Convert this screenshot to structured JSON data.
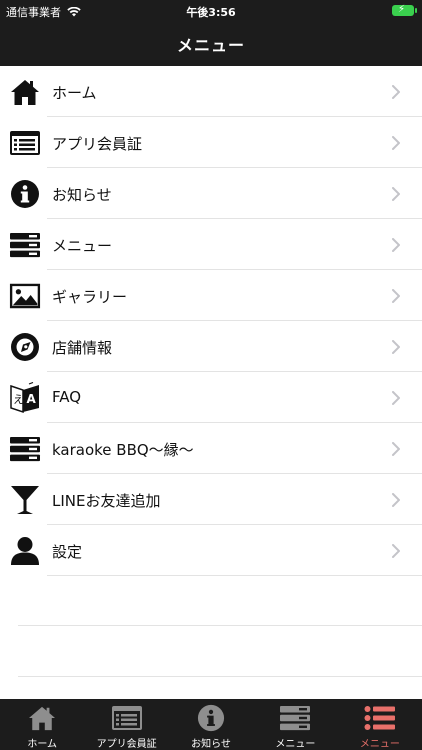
{
  "status_bar": {
    "carrier": "通信事業者",
    "time": "午後3:56",
    "battery_color": "#3ad04e"
  },
  "nav": {
    "title": "メニュー"
  },
  "menu": {
    "items": [
      {
        "label": "ホーム",
        "icon": "home-icon"
      },
      {
        "label": "アプリ会員証",
        "icon": "member-card-icon"
      },
      {
        "label": "お知らせ",
        "icon": "info-icon"
      },
      {
        "label": "メニュー",
        "icon": "menu-list-icon"
      },
      {
        "label": "ギャラリー",
        "icon": "gallery-icon"
      },
      {
        "label": "店舗情報",
        "icon": "compass-icon"
      },
      {
        "label": "FAQ",
        "icon": "translate-icon"
      },
      {
        "label": "karaoke BBQ〜縁〜",
        "icon": "menu-list-icon"
      },
      {
        "label": "LINEお友達追加",
        "icon": "cocktail-icon"
      },
      {
        "label": "設定",
        "icon": "user-icon"
      }
    ]
  },
  "tabbar": {
    "active_color": "#e8706a",
    "tabs": [
      {
        "label": "ホーム",
        "icon": "home-icon"
      },
      {
        "label": "アプリ会員証",
        "icon": "member-card-icon"
      },
      {
        "label": "お知らせ",
        "icon": "info-icon"
      },
      {
        "label": "メニュー",
        "icon": "menu-list-icon"
      },
      {
        "label": "メニュー",
        "icon": "list-icon",
        "active": true
      }
    ]
  }
}
